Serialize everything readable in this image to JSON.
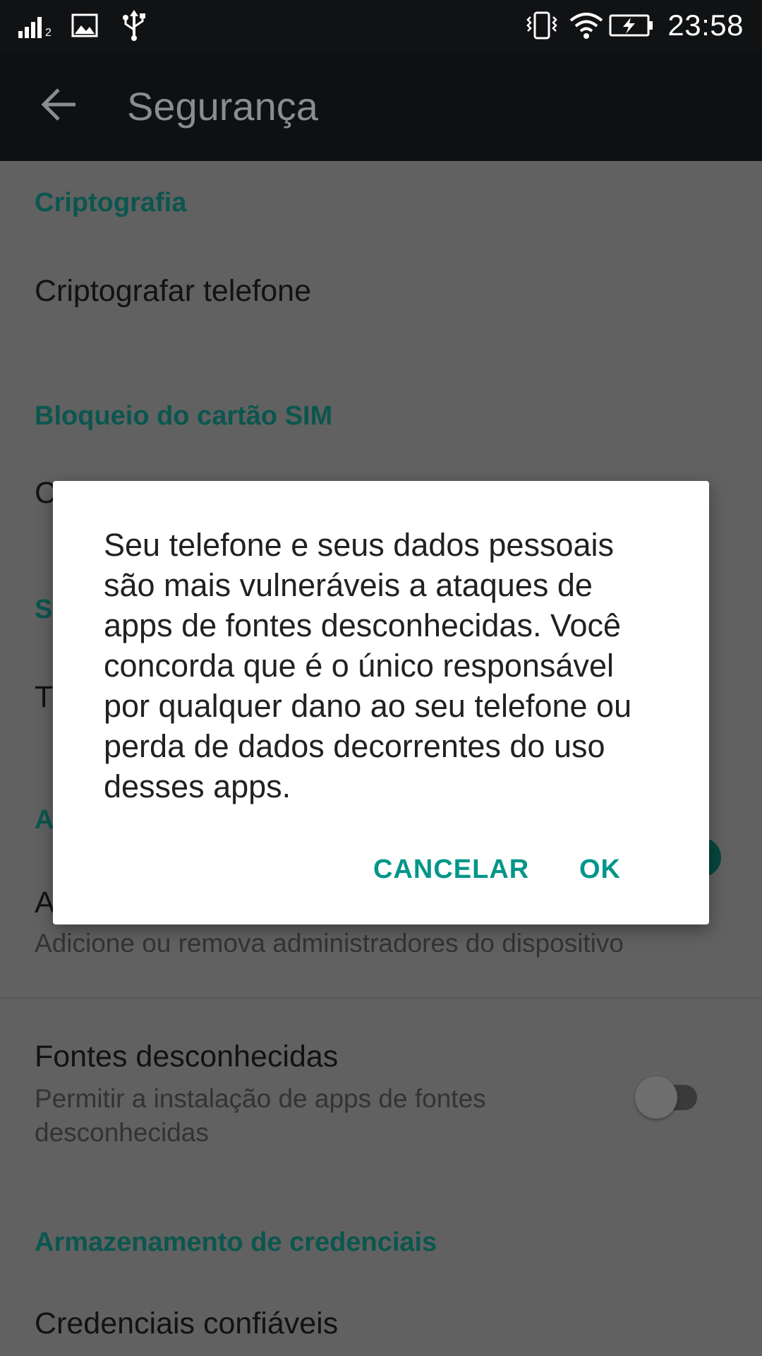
{
  "status_bar": {
    "time": "23:58",
    "icons": [
      "signal-icon",
      "image-icon",
      "usb-icon",
      "vibrate-icon",
      "wifi-icon",
      "battery-charging-icon"
    ],
    "signal_sub": "2"
  },
  "toolbar": {
    "title": "Segurança",
    "back_icon": "arrow-back-icon"
  },
  "settings": {
    "sections": [
      {
        "header": "Criptografia"
      },
      {
        "header": "Bloqueio do cartão SIM"
      },
      {
        "header": "Armazenamento de credenciais"
      }
    ],
    "items": {
      "encrypt": {
        "title": "Criptografar telefone"
      },
      "sim_partial": {
        "title": "C"
      },
      "section_s_partial": "S",
      "item_t_partial": {
        "title": "T"
      },
      "section_a_partial": "A",
      "device_admin_partial": {
        "title": "A",
        "summary": "Adicione ou remova administradores do dispositivo"
      },
      "unknown_sources": {
        "title": "Fontes desconhecidas",
        "summary": "Permitir a instalação de apps de fontes desconhecidas",
        "enabled": false
      },
      "trusted_credentials": {
        "title": "Credenciais confiáveis"
      }
    }
  },
  "dialog": {
    "message": "Seu telefone e seus dados pessoais são mais vulneráveis a ataques de apps de fontes desconhecidas. Você concorda que é o único responsável por qualquer dano ao seu telefone ou perda de dados decorrentes do uso desses apps.",
    "cancel_label": "CANCELAR",
    "ok_label": "OK"
  },
  "colors": {
    "accent": "#009688",
    "status_bar": "#101214",
    "toolbar": "#0d1113",
    "scrim_background": "#616161"
  }
}
